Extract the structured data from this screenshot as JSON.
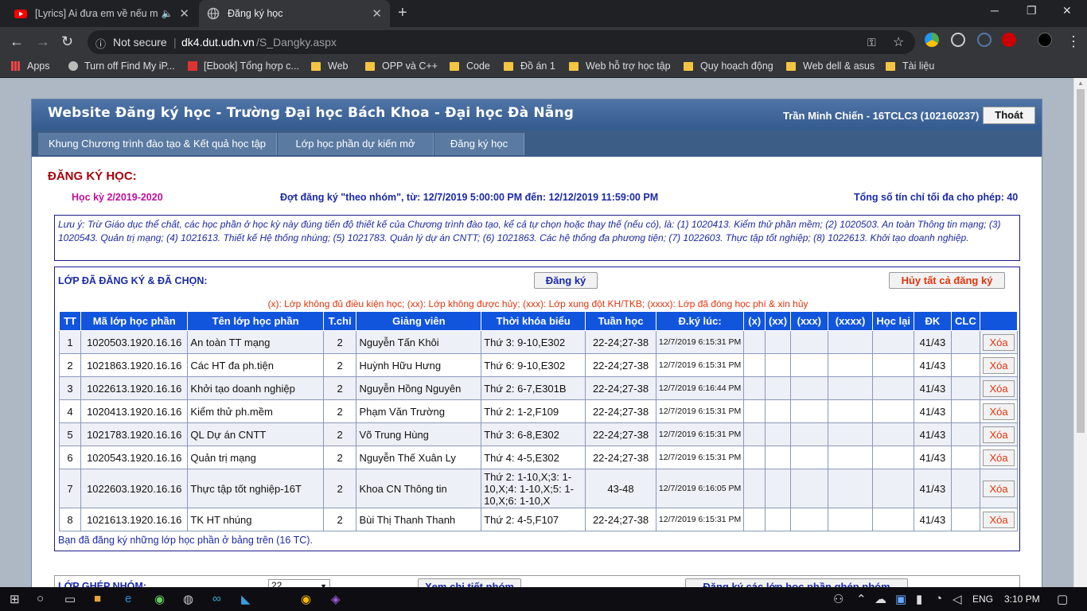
{
  "browser": {
    "tabs": [
      {
        "title": "[Lyrics] Ai đưa em về nếu mộ",
        "active": false
      },
      {
        "title": "Đăng ký học",
        "active": true
      }
    ],
    "url_security": "Not secure",
    "url_host": "dk4.dut.udn.vn",
    "url_path": "/S_Dangky.aspx",
    "bookmarks": [
      "Apps",
      "Turn off Find My iP...",
      "[Ebook] Tổng hợp c...",
      "Web",
      "OPP và C++",
      "Code",
      "Đồ án 1",
      "Web hỗ trợ học tập",
      "Quy hoạch động",
      "Web dell & asus",
      "Tài liệu"
    ]
  },
  "header": {
    "title": "Website Đăng ký học - Trường Đại học Bách Khoa - Đại học Đà Nẵng",
    "user": "Trần Minh Chiến - 16TCLC3 (102160237)",
    "logout": "Thoát"
  },
  "menu": [
    "Khung Chương trình đào tạo & Kết quả học tập",
    "Lớp học phần dự kiến mở",
    "Đăng ký học"
  ],
  "page": {
    "section_title": "ĐĂNG KÝ HỌC:",
    "semester": "Học kỳ 2/2019-2020",
    "period": "Đợt đăng ký \"theo nhóm\", từ: 12/7/2019 5:00:00 PM đến: 12/12/2019 11:59:00 PM",
    "max_credits": "Tổng số tín chỉ tối đa cho phép: 40",
    "note": "Lưu ý: Trừ Giáo dục thể chất, các học phần ở học kỳ này đúng tiến độ thiết kế của Chương trình đào tạo, kể cả tự chọn hoặc thay thế (nếu có), là: (1) 1020413. Kiểm thử phần mềm; (2) 1020503. An toàn Thông tin mạng; (3) 1020543. Quản trị mạng; (4) 1021613. Thiết kế Hệ thống nhúng; (5) 1021783. Quản lý dự án CNTT; (6) 1021863. Các hệ thống đa phương tiện; (7) 1022603. Thực tập tốt nghiệp; (8) 1022613. Khởi tạo doanh nghiệp.",
    "registered_title": "LỚP ĐÃ ĐĂNG KÝ & ĐÃ CHỌN:",
    "register_button": "Đăng ký",
    "cancel_all_button": "Hủy tất cả đăng ký",
    "legend": "(x): Lớp không đủ điều kiện học; (xx): Lớp không được hủy; (xxx): Lớp xung đột KH/TKB; (xxxx): Lớp đã đóng học phí & xin hủy",
    "summary": "Bạn đã đăng ký những lớp học phần ở bảng trên (16 TC).",
    "group_label": "LỚP GHÉP NHÓM:",
    "group_value": "22",
    "group_detail_button": "Xem chi tiết nhóm",
    "group_register_button": "Đăng ký các lớp học phần ghép nhóm"
  },
  "table": {
    "headers": [
      "TT",
      "Mã lớp học phần",
      "Tên lớp học phần",
      "T.chỉ",
      "Giảng viên",
      "Thời khóa biểu",
      "Tuần học",
      "Đ.ký lúc:",
      "(x)",
      "(xx)",
      "(xxx)",
      "(xxxx)",
      "Học lại",
      "ĐK",
      "CLC",
      ""
    ],
    "delete_label": "Xóa",
    "rows": [
      [
        "1",
        "1020503.1920.16.16",
        "An toàn TT mạng",
        "2",
        "Nguyễn Tấn Khôi",
        "Thứ 3: 9-10,E302",
        "22-24;27-38",
        "12/7/2019 6:15:31 PM",
        "41/43"
      ],
      [
        "2",
        "1021863.1920.16.16",
        "Các HT đa ph.tiện",
        "2",
        "Huỳnh Hữu Hưng",
        "Thứ 6: 9-10,E302",
        "22-24;27-38",
        "12/7/2019 6:15:31 PM",
        "41/43"
      ],
      [
        "3",
        "1022613.1920.16.16",
        "Khởi tạo doanh nghiệp",
        "2",
        "Nguyễn Hồng Nguyên",
        "Thứ 2: 6-7,E301B",
        "22-24;27-38",
        "12/7/2019 6:16:44 PM",
        "41/43"
      ],
      [
        "4",
        "1020413.1920.16.16",
        "Kiểm thử ph.mềm",
        "2",
        "Phạm Văn Trường",
        "Thứ 2: 1-2,F109",
        "22-24;27-38",
        "12/7/2019 6:15:31 PM",
        "41/43"
      ],
      [
        "5",
        "1021783.1920.16.16",
        "QL Dự án CNTT",
        "2",
        "Võ Trung Hùng",
        "Thứ 3: 6-8,E302",
        "22-24;27-38",
        "12/7/2019 6:15:31 PM",
        "41/43"
      ],
      [
        "6",
        "1020543.1920.16.16",
        "Quản trị mạng",
        "2",
        "Nguyễn Thế Xuân Ly",
        "Thứ 4: 4-5,E302",
        "22-24;27-38",
        "12/7/2019 6:15:31 PM",
        "41/43"
      ],
      [
        "7",
        "1022603.1920.16.16",
        "Thực tập tốt nghiệp-16T",
        "2",
        "Khoa CN Thông tin",
        "Thứ 2: 1-10,X;3: 1-10,X;4: 1-10,X;5: 1-10,X;6: 1-10,X",
        "43-48",
        "12/7/2019 6:16:05 PM",
        "41/43"
      ],
      [
        "8",
        "1021613.1920.16.16",
        "TK HT nhúng",
        "2",
        "Bùi Thị Thanh Thanh",
        "Thứ 2: 4-5,F107",
        "22-24;27-38",
        "12/7/2019 6:15:31 PM",
        "41/43"
      ]
    ]
  },
  "taskbar": {
    "lang": "ENG",
    "time": "3:10 PM"
  },
  "colors": {
    "header_blue": "#345b90",
    "menu_blue": "#3c5d86",
    "table_header": "#1155dd",
    "section_red": "#a8000a",
    "text_navy": "#1b2aa6",
    "legend_red": "#e3340b"
  }
}
